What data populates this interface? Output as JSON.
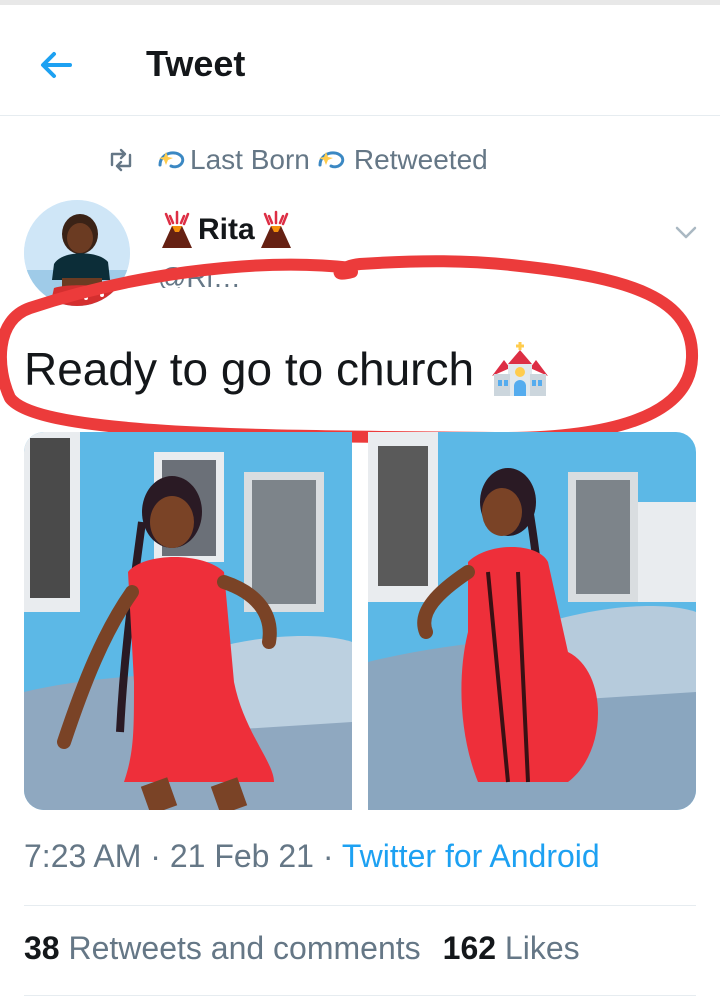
{
  "header": {
    "title": "Tweet",
    "back_icon": "back-arrow-icon",
    "accent_color": "#1da1f2"
  },
  "retweet": {
    "user": "Last Born",
    "label": "Retweeted",
    "icon": "retweet-icon"
  },
  "tweet": {
    "name": "Rita",
    "handle": "@Ri…",
    "text": "Ready to go to church",
    "emoji_name_decor": "volcano-emoji",
    "emoji_text": "church-emoji",
    "time": "7:23 AM",
    "date": "21 Feb 21",
    "source": "Twitter for Android",
    "separator": "·"
  },
  "stats": {
    "retweets_count": "38",
    "retweets_label": "Retweets and comments",
    "likes_count": "162",
    "likes_label": "Likes"
  },
  "annotation": {
    "color": "#ec3b3b"
  }
}
